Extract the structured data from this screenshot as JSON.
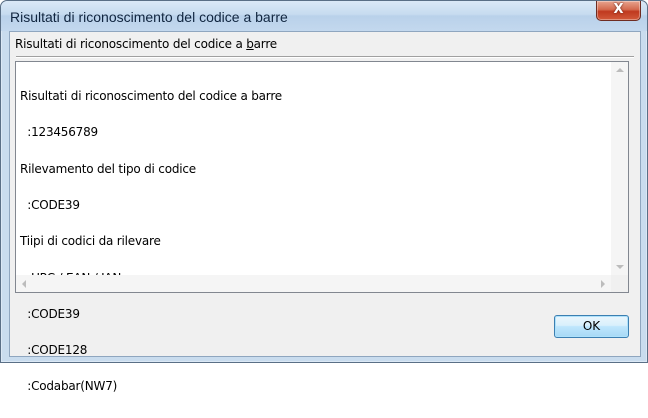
{
  "window": {
    "title": "Risultati di riconoscimento del codice a barre",
    "close_glyph": "X",
    "close_icon": "close-icon"
  },
  "group": {
    "label_before": "Risultati di riconoscimento del codice a ",
    "label_mnemonic": "b",
    "label_after": "arre"
  },
  "result_text": {
    "lines": [
      "Risultati di riconoscimento del codice a barre",
      "  :123456789",
      "Rilevamento del tipo di codice",
      "  :CODE39",
      "Tiipi di codici da rilevare",
      "  :UPC / EAN / JAN",
      "  :CODE39",
      "  :CODE128",
      "  :Codabar(NW7)"
    ]
  },
  "buttons": {
    "ok_label": "OK"
  },
  "colors": {
    "title_bar": "#c6dbef",
    "close_button": "#c0391f",
    "dialog_background": "#f0f0f0",
    "ok_border": "#3c7fb1"
  }
}
